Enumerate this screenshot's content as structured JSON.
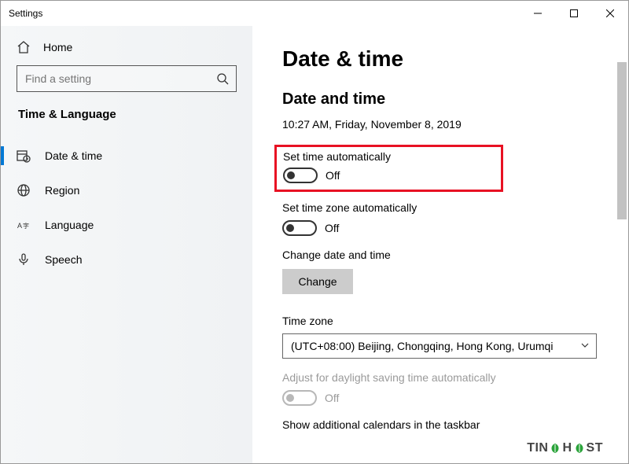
{
  "window": {
    "title": "Settings"
  },
  "sidebar": {
    "home_label": "Home",
    "search_placeholder": "Find a setting",
    "section_label": "Time & Language",
    "items": [
      {
        "label": "Date & time"
      },
      {
        "label": "Region"
      },
      {
        "label": "Language"
      },
      {
        "label": "Speech"
      }
    ]
  },
  "content": {
    "page_title": "Date & time",
    "subheading": "Date and time",
    "current_datetime": "10:27 AM, Friday, November 8, 2019",
    "set_time_auto": {
      "label": "Set time automatically",
      "state": "Off"
    },
    "set_tz_auto": {
      "label": "Set time zone automatically",
      "state": "Off"
    },
    "change_datetime": {
      "label": "Change date and time",
      "button": "Change"
    },
    "timezone": {
      "label": "Time zone",
      "value": "(UTC+08:00) Beijing, Chongqing, Hong Kong, Urumqi"
    },
    "dst_auto": {
      "label": "Adjust for daylight saving time automatically",
      "state": "Off"
    },
    "additional_calendars_label": "Show additional calendars in the taskbar"
  },
  "brand": {
    "part1": "TIN",
    "part2": "H",
    "part3": "ST"
  }
}
